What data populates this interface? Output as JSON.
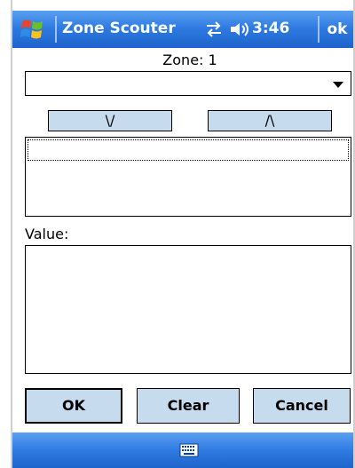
{
  "titlebar": {
    "app_title": "Zone Scouter",
    "clock": "3:46",
    "ok_label": "ok",
    "icons": [
      "windows-start-icon",
      "connectivity-icon",
      "speaker-icon"
    ]
  },
  "form": {
    "zone_label": "Zone: 1",
    "dropdown_value": "",
    "down_button": "\\/",
    "up_button": "/\\",
    "list_items": [
      ""
    ],
    "value_label": "Value:",
    "value_text": ""
  },
  "actions": {
    "ok": "OK",
    "clear": "Clear",
    "cancel": "Cancel"
  },
  "menubar": {
    "icon": "keyboard-icon"
  },
  "colors": {
    "title_bar": "#2f7be2",
    "button_face": "#c7dbee"
  }
}
